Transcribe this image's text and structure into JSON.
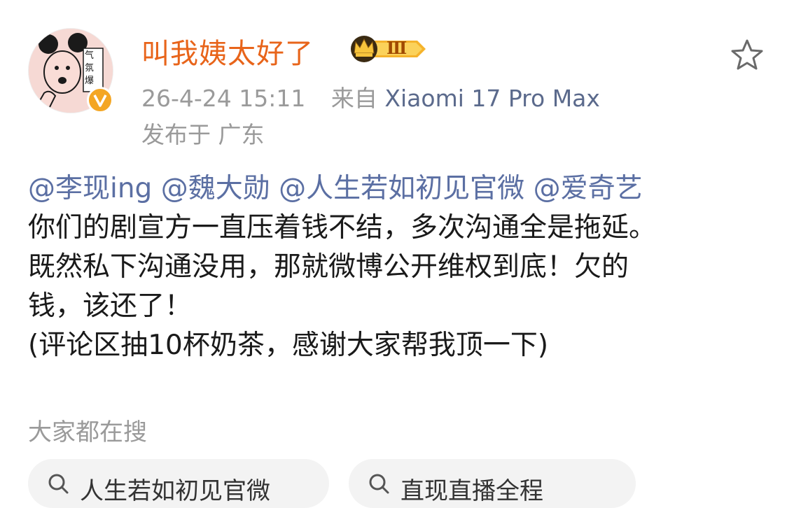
{
  "author": {
    "name": "叫我姨太好了",
    "vip_level": "Ⅲ",
    "avatar_text": "气氛爆",
    "avatar_icon": "cartoon-mouse-ears-avatar",
    "verified_icon": "verified-v-badge",
    "name_color": "#e8641a"
  },
  "meta": {
    "time": "26-4-24 15:11",
    "source_prefix": "来自",
    "device": "Xiaomi 17 Pro Max",
    "location": "发布于 广东"
  },
  "post": {
    "mentions": [
      "@李现ing",
      "@魏大勋",
      "@人生若如初见官微",
      "@爱奇艺"
    ],
    "lines": [
      "你们的剧宣方一直压着钱不结，多次沟通全是拖延。",
      "既然私下沟通没用，那就微博公开维权到底！欠的",
      "钱，该还了！",
      "(评论区抽10杯奶茶，感谢大家帮我顶一下)"
    ]
  },
  "related": {
    "title": "大家都在搜",
    "chips": [
      {
        "label": "人生若如初见官微",
        "icon": "search-icon"
      },
      {
        "label": "直现直播全程",
        "icon": "search-icon"
      }
    ]
  },
  "colors": {
    "mention": "#5b6fa3",
    "muted": "#9a9a9a",
    "device": "#5b6a8c"
  }
}
